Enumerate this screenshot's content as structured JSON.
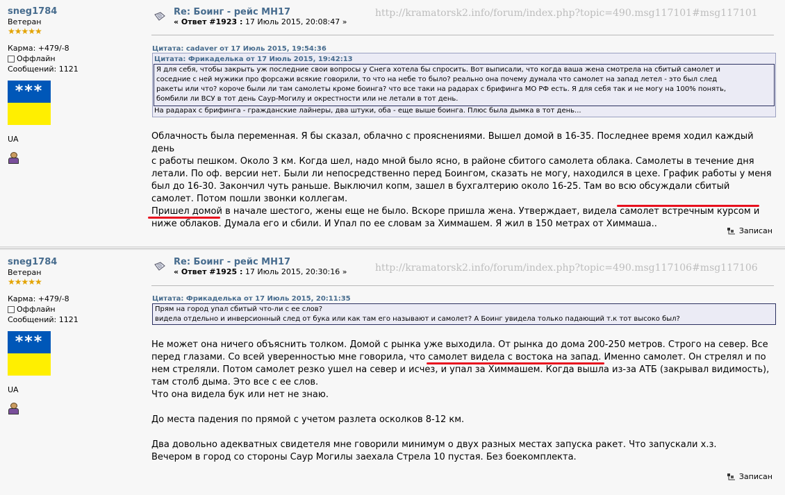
{
  "posts": [
    {
      "author": "sneg1784",
      "rank": "Ветеран",
      "stars": "★★★★★",
      "karma": "Карма: +479/-8",
      "status": "Оффлайн",
      "messages": "Сообщений: 1121",
      "flag_text": "***",
      "country": "UA",
      "subject": "Re: Боинг - рейс МН17",
      "reply_label": "« Ответ #1923 :",
      "date": " 17 Июль 2015, 20:08:47 »",
      "watermark": "http://kramatorsk2.info/forum/index.php?topic=490.msg117101#msg117101",
      "quote_outer_header": "Цитата: cadaver от 17 Июль 2015, 19:54:36",
      "quote_inner_header": "Цитата: Фрикаделька от 17 Июль 2015, 19:42:13",
      "quote_inner_lines": [
        "Я для себя, чтобы закрыть уж последние свои вопросы у Снега хотела бы спросить. Вот выписали, что когда ваша жена смотрела на сбитый самолет и",
        "соседние с ней мужики про форсажи всякие говорили, то что на небе то было? реально она почему думала что самолет на запад летел - это был след",
        "ракеты или что? короче были ли там самолеты кроме боинга? что все таки на радарах с брифинга МО РФ есть. Я для себя так и не могу на 100% понять,",
        "бомбили ли ВСУ в тот день Саур-Могилу и окрестности или не летали в тот день."
      ],
      "quote_outer_tail": "На радарах с брифинга - гражданские лайнеры, два штуки, оба - еще выше боинга. Плюс была дымка в тот день...",
      "body_lines": [
        "Облачность была переменная. Я бы сказал, облачно с прояснениями. Вышел домой в 16-35. Последнее время ходил каждый день",
        "с работы пешком. Около 3 км. Когда шел, надо мной было ясно, в районе сбитого самолета облака. Самолеты в течение дня",
        "летали. По оф. версии нет. Были ли непосредственно перед Боингом, сказать не могу, находился в цехе. График работы у меня",
        "был до 16-30. Закончил чуть раньше. Выключил копм, зашел в бухгалтерию около 16-25. Там во всю обсуждали сбитый",
        "самолет. Потом пошли звонки коллегам.",
        "Пришел домой в начале шестого, жены еще не было. Вскоре пришла жена. Утверждает, видела самолет встречным курсом и",
        "ниже облаков. Думала его и сбили. И Упал по ее словам за Химмашем. Я жил в 150 метрах от Химмаша.."
      ],
      "saved": "Записан"
    },
    {
      "author": "sneg1784",
      "rank": "Ветеран",
      "stars": "★★★★★",
      "karma": "Карма: +479/-8",
      "status": "Оффлайн",
      "messages": "Сообщений: 1121",
      "flag_text": "***",
      "country": "UA",
      "subject": "Re: Боинг - рейс МН17",
      "reply_label": "« Ответ #1925 :",
      "date": " 17 Июль 2015, 20:30:16 »",
      "watermark": "http://kramatorsk2.info/forum/index.php?topic=490.msg117106#msg117106",
      "quote_header": "Цитата: Фрикаделька от 17 Июль 2015, 20:11:35",
      "quote_lines": [
        "Прям на город упал сбитый что-ли с ее слов?",
        "видела отдельно и инверсионный след  от бука или как там его называют и самолет? А Боинг увидела только падающий т.к  тот высоко был?"
      ],
      "body_lines": [
        "Не может она ничего объяснить толком. Домой с рынка уже выходила. От рынка до дома 200-250 метров. Строго на север. Все",
        "перед глазами. Со всей уверенностью мне говорила, что самолет видела с востока на запад. Именно самолет. Он стрелял и по",
        "нем стреляли. Потом самолет резко ушел на север и исчез, и упал за Химмашем. Когда вышла из-за АТБ (закрывал видимость),",
        "там столб дыма. Это все с ее слов.",
        "Что она видела бук или нет не знаю.",
        "",
        "До места падения по прямой с учетом разлета осколков 8-12 км.",
        "",
        "Два довольно адекватных свидетеля мне говорили минимум о двух разных местах запуска ракет. Что запускали х.з.",
        "Вечером в город со стороны Саур Могилы заехала Стрела 10 пустая. Без боекомплекта."
      ],
      "saved": "Записан"
    }
  ],
  "colors": {
    "link": "#476c8e",
    "quote_bg": "#ebebf5",
    "underline": "#e8101e",
    "flag_blue": "#0057b8",
    "flag_yellow": "#ffef00"
  }
}
